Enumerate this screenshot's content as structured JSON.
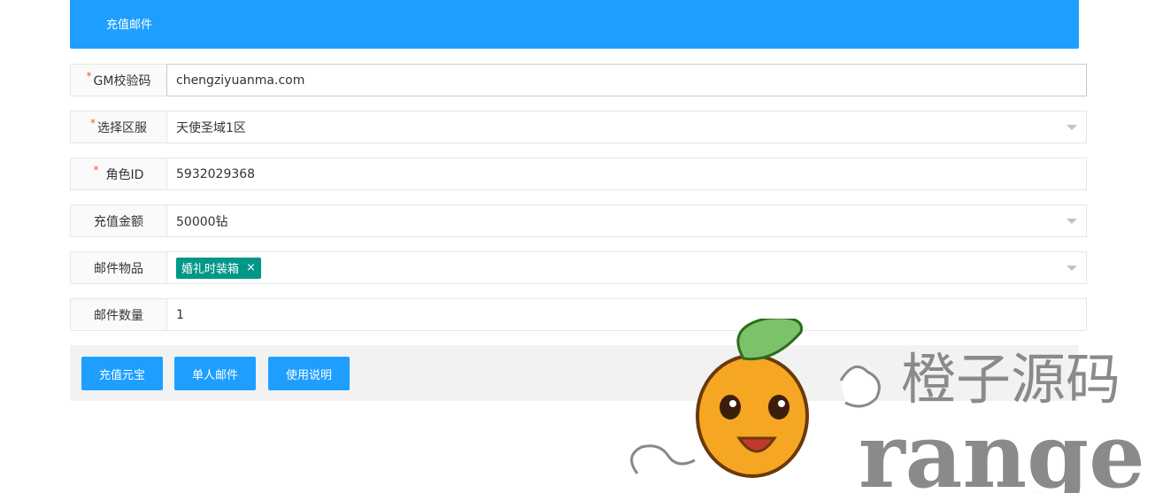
{
  "header": {
    "title": "充值邮件"
  },
  "form": {
    "gm_code": {
      "label": "GM校验码",
      "required": true,
      "value": "chengziyuanma.com"
    },
    "server": {
      "label": "选择区服",
      "required": true,
      "value": "天使圣域1区"
    },
    "role_id": {
      "label": "角色ID",
      "required": true,
      "value": "5932029368"
    },
    "amount": {
      "label": "充值金额",
      "required": false,
      "value": "50000钻"
    },
    "items": {
      "label": "邮件物品",
      "required": false,
      "tag": "婚礼时装箱",
      "tag_close": "×"
    },
    "count": {
      "label": "邮件数量",
      "required": false,
      "value": "1"
    }
  },
  "buttons": {
    "recharge": "充值元宝",
    "single_mail": "单人邮件",
    "help": "使用说明"
  },
  "required_mark": "*",
  "watermark": {
    "cn": "橙子源码",
    "en": "range"
  },
  "colors": {
    "primary": "#1e9fff",
    "tag": "#009688",
    "required": "#ff5722",
    "toolbar_bg": "#f2f2f2"
  }
}
